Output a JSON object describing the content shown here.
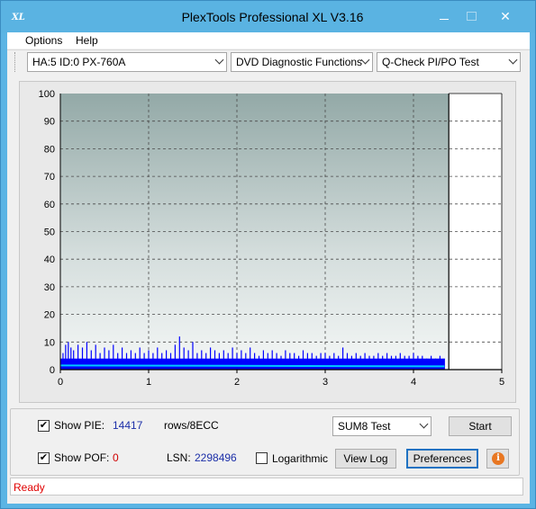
{
  "window": {
    "title": "PlexTools Professional XL V3.16",
    "icon_text": "XL"
  },
  "menu": [
    {
      "label": "Options",
      "accel": "O"
    },
    {
      "label": "Help",
      "accel": "H"
    }
  ],
  "toolbar": {
    "drive": "HA:5 ID:0  PX-760A",
    "function": "DVD Diagnostic Functions",
    "test": "Q-Check PI/PO Test"
  },
  "chart_data": {
    "type": "bar",
    "x_ticks": [
      "0",
      "1",
      "2",
      "3",
      "4",
      "5"
    ],
    "y_ticks": [
      "0",
      "10",
      "20",
      "30",
      "40",
      "50",
      "60",
      "70",
      "80",
      "90",
      "100"
    ],
    "xlim": [
      0,
      5
    ],
    "ylim": [
      0,
      100
    ],
    "grid": true,
    "end_marker_x": 4.4,
    "series": [
      {
        "color": "#0000ff",
        "x": [
          0.03,
          0.06,
          0.09,
          0.12,
          0.15,
          0.2,
          0.25,
          0.3,
          0.35,
          0.4,
          0.45,
          0.5,
          0.55,
          0.6,
          0.65,
          0.7,
          0.75,
          0.8,
          0.85,
          0.9,
          0.95,
          1.0,
          1.05,
          1.1,
          1.15,
          1.2,
          1.25,
          1.3,
          1.35,
          1.4,
          1.45,
          1.5,
          1.55,
          1.6,
          1.65,
          1.7,
          1.75,
          1.8,
          1.85,
          1.9,
          1.95,
          2.0,
          2.05,
          2.1,
          2.15,
          2.2,
          2.25,
          2.3,
          2.35,
          2.4,
          2.45,
          2.5,
          2.55,
          2.6,
          2.65,
          2.7,
          2.75,
          2.8,
          2.85,
          2.9,
          2.95,
          3.0,
          3.05,
          3.1,
          3.15,
          3.2,
          3.25,
          3.3,
          3.35,
          3.4,
          3.45,
          3.5,
          3.55,
          3.6,
          3.65,
          3.7,
          3.75,
          3.8,
          3.85,
          3.9,
          3.95,
          4.0,
          4.05,
          4.1,
          4.15,
          4.2,
          4.25,
          4.3,
          4.35
        ],
        "y": [
          6,
          9,
          10,
          8,
          7,
          9,
          8,
          10,
          7,
          9,
          6,
          8,
          7,
          9,
          6,
          8,
          6,
          7,
          6,
          8,
          6,
          7,
          6,
          8,
          6,
          7,
          6,
          9,
          12,
          8,
          7,
          10,
          6,
          7,
          6,
          8,
          7,
          6,
          7,
          6,
          8,
          6,
          7,
          6,
          8,
          6,
          5,
          7,
          6,
          7,
          6,
          5,
          7,
          6,
          6,
          5,
          7,
          6,
          6,
          5,
          6,
          6,
          5,
          6,
          5,
          8,
          6,
          5,
          6,
          5,
          6,
          5,
          5,
          6,
          5,
          6,
          5,
          5,
          6,
          5,
          5,
          6,
          5,
          5,
          4,
          5,
          4,
          5,
          4
        ]
      },
      {
        "color": "#00c8ff",
        "x": [
          0,
          4.35
        ],
        "y": [
          1.5,
          1.2
        ]
      }
    ]
  },
  "controls": {
    "show_pie_label": "Show PIE:",
    "show_pie_checked": "✔",
    "pie_value": "14417",
    "pie_unit": "rows/8ECC",
    "show_poe_label": "Show POF:",
    "show_poe_checked": "✔",
    "poe_value": "0",
    "lsn_label": "LSN:",
    "lsn_value": "2298496",
    "logarithmic_label": "Logarithmic",
    "sum_select": "SUM8 Test",
    "start_button": "Start",
    "viewlog_button": "View Log",
    "preferences_button": "Preferences",
    "info_glyph": "i"
  },
  "status": "Ready"
}
